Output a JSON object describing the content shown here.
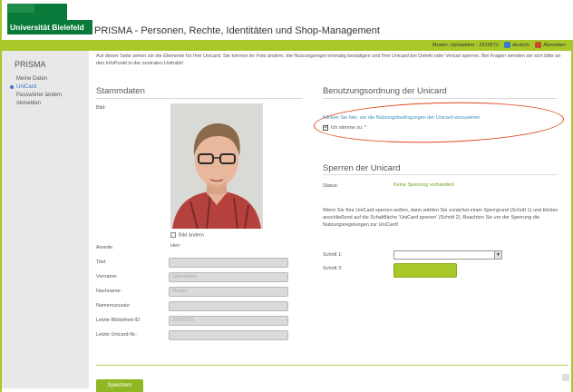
{
  "header": {
    "university": "Universität Bielefeld",
    "app_title": "PRISMA - Personen, Rechte, Identitäten und Shop-Management"
  },
  "userbar": {
    "user": "Muster, Uploaddrer - 2519572",
    "language": "deutsch",
    "logout": "Abmelden"
  },
  "sidebar": {
    "title": "PRISMA",
    "items": [
      {
        "label": "Meine Daten"
      },
      {
        "label": "UniCard"
      },
      {
        "label": "Passwörter ändern"
      },
      {
        "label": "Abmelden"
      }
    ]
  },
  "intro": "Auf dieser Seite sehen sie die Elemente für Ihre Unicard. Sie können ihr Foto ändern, die Nutzungsregel einmalig bestätigen und Ihre Unicard bei Defekt oder Verlust sperren. Bei Fragen wenden sie sich bitte an den InfoPunkt in der zentralen Unihalle!",
  "stammdaten": {
    "title": "Stammdaten",
    "bild_label": "Bild:",
    "edit_photo": "Bild ändern",
    "anrede_label": "Anrede:",
    "anrede_value": "Herr",
    "titel_label": "Titel:",
    "vorname_label": "Vorname:",
    "vorname_value": "Uploaddrer",
    "nachname_label": "Nachname:",
    "nachname_value": "Muster",
    "namenszusatz_label": "Namenszusatz:",
    "bibliothek_label": "Letzte Bibliothek-ID:",
    "bibliothek_value": "25195721",
    "unicard_nr_label": "Letzte Unicard-Nr.:"
  },
  "benutzung": {
    "title": "Benutzungsordnung der Unicard",
    "link": "Klicken Sie hier, um die Nutzungsbedingungen der Unicard einzusehen",
    "agree": "Ich stimme zu: *"
  },
  "sperren": {
    "title": "Sperren der Unicard",
    "status_label": "Status:",
    "status_value": "Keine Sperrung vorhanden!",
    "text": "Wenn Sie Ihre UniCard sperren wollen, dann wählen Sie zunächst einen Sperrgrund (Schritt 1) und klicken anschließend auf die Schaltfläche 'UniCard sperren' (Schritt 2). Beachten Sie vor der Sperrung die Nutzungsregelungen zur UniCard!",
    "schritt1_label": "Schritt 1:",
    "schritt2_label": "Schritt 2:"
  },
  "footer": {
    "save": "Speichern"
  },
  "colors": {
    "brand_green": "#0a7a3a",
    "lime": "#a8c82a",
    "annotation_red": "#e0481c"
  }
}
